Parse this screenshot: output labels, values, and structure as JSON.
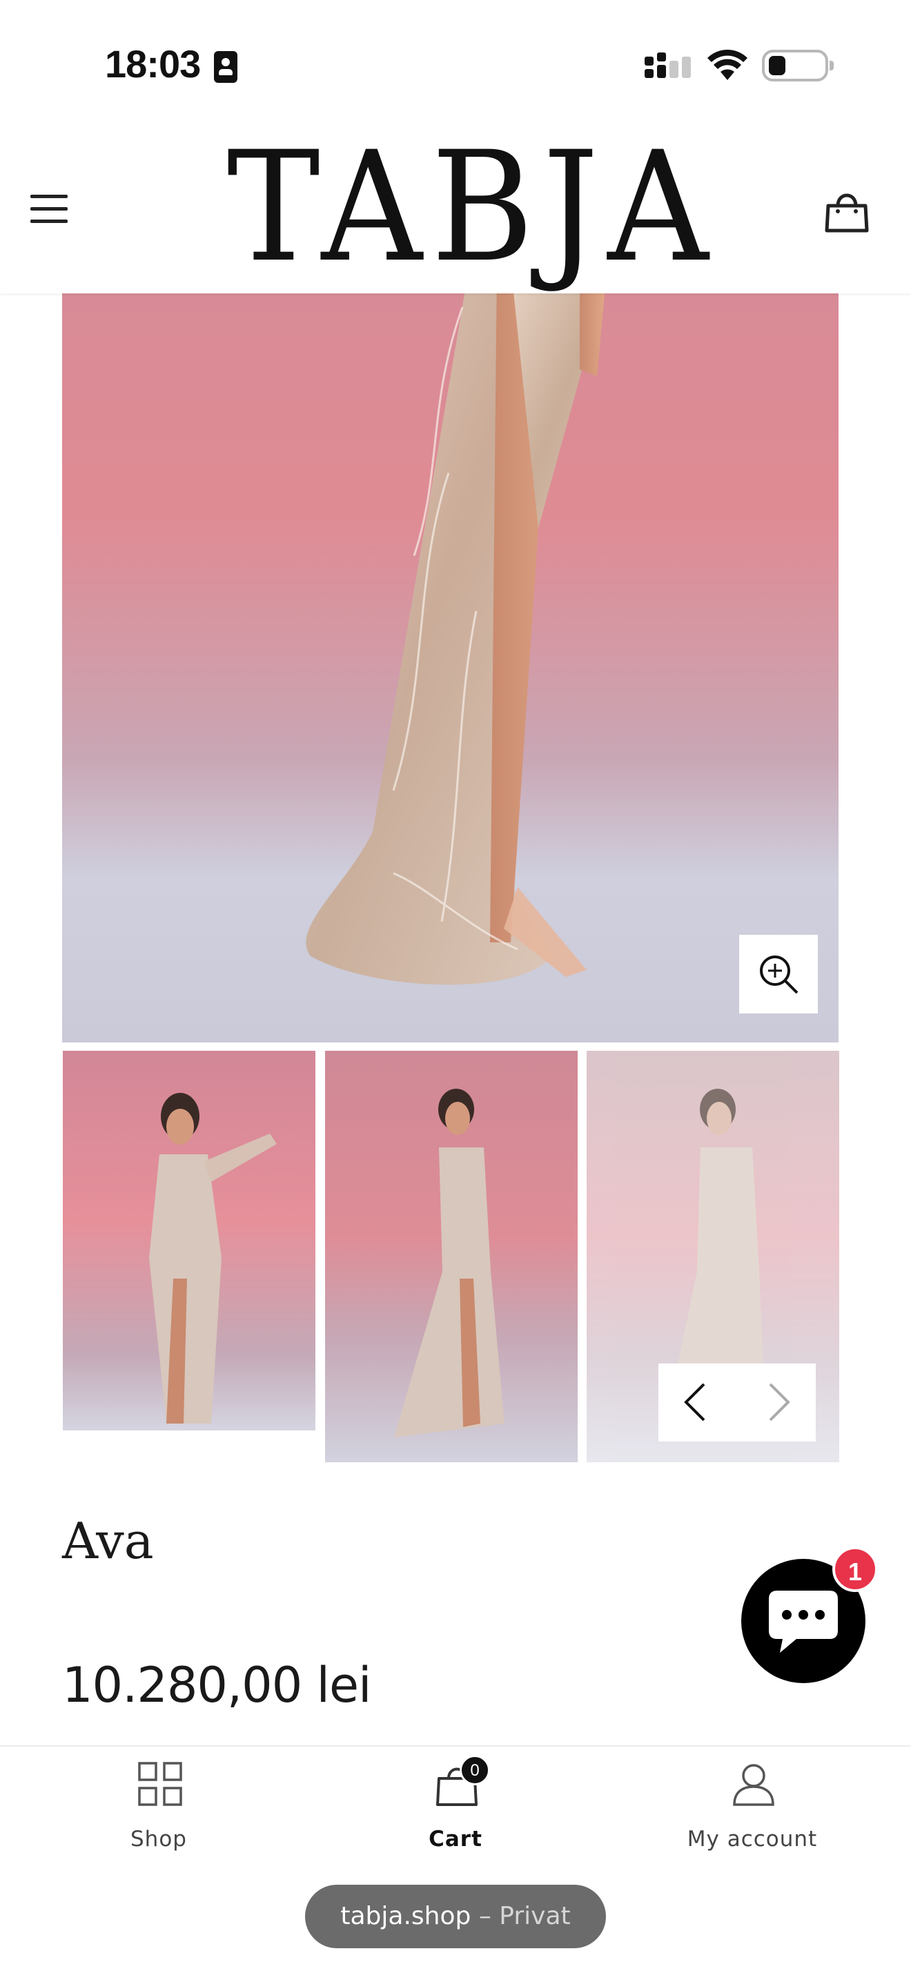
{
  "status_bar": {
    "time": "18:03"
  },
  "header": {
    "logo": "TABJA",
    "cart_count": "0"
  },
  "product": {
    "title": "Ava",
    "price": "10.280,00 lei"
  },
  "chat": {
    "badge_count": "1"
  },
  "bottom_nav": {
    "items": [
      {
        "label": "Shop",
        "icon": "grid-icon"
      },
      {
        "label": "Cart",
        "icon": "bag-icon",
        "badge": "0"
      },
      {
        "label": "My account",
        "icon": "user-icon"
      }
    ]
  },
  "browser": {
    "domain": "tabja.shop",
    "mode": "– Privat"
  }
}
